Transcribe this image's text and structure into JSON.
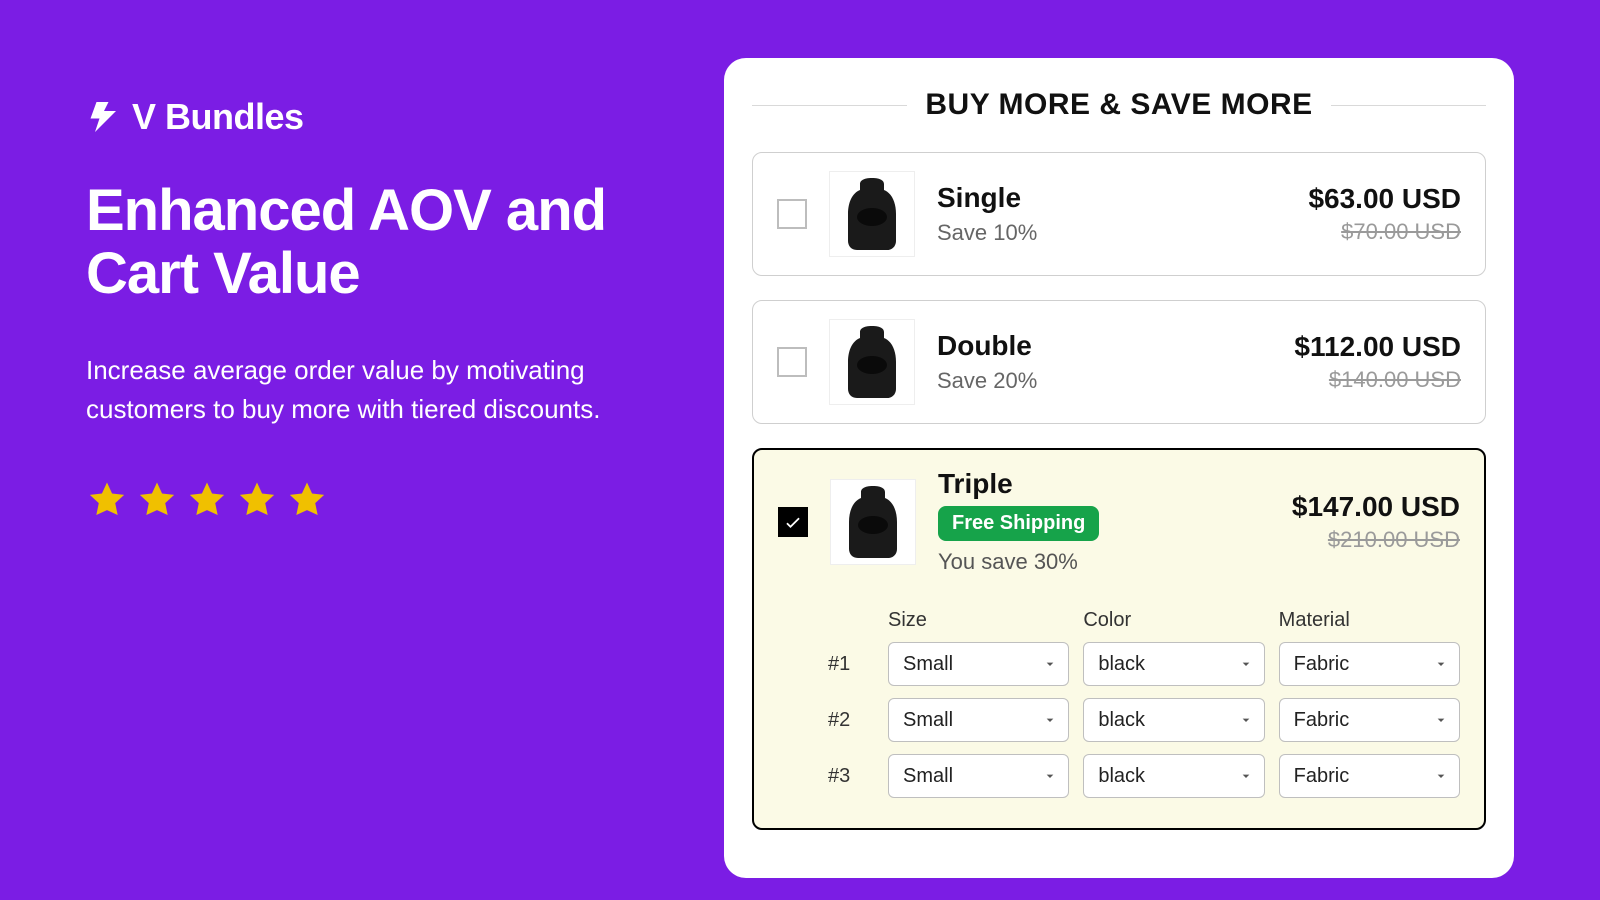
{
  "brand": {
    "name": "V Bundles"
  },
  "hero": {
    "headline": "Enhanced AOV and Cart Value",
    "subhead": "Increase average order value by motivating customers to buy more with tiered discounts."
  },
  "rating": {
    "stars": 5
  },
  "widget": {
    "title": "BUY MORE & SAVE MORE",
    "tiers": [
      {
        "name": "Single",
        "save": "Save 10%",
        "price": "$63.00 USD",
        "original": "$70.00 USD",
        "selected": false
      },
      {
        "name": "Double",
        "save": "Save 20%",
        "price": "$112.00 USD",
        "original": "$140.00 USD",
        "selected": false
      },
      {
        "name": "Triple",
        "badge": "Free Shipping",
        "save": "You save 30%",
        "price": "$147.00 USD",
        "original": "$210.00 USD",
        "selected": true
      }
    ],
    "variant_labels": {
      "size": "Size",
      "color": "Color",
      "material": "Material"
    },
    "variant_rows": [
      {
        "idx": "#1",
        "size": "Small",
        "color": "black",
        "material": "Fabric"
      },
      {
        "idx": "#2",
        "size": "Small",
        "color": "black",
        "material": "Fabric"
      },
      {
        "idx": "#3",
        "size": "Small",
        "color": "black",
        "material": "Fabric"
      }
    ]
  },
  "colors": {
    "accent": "#7b1de4",
    "badge_green": "#16a34a",
    "star": "#f0c000"
  }
}
